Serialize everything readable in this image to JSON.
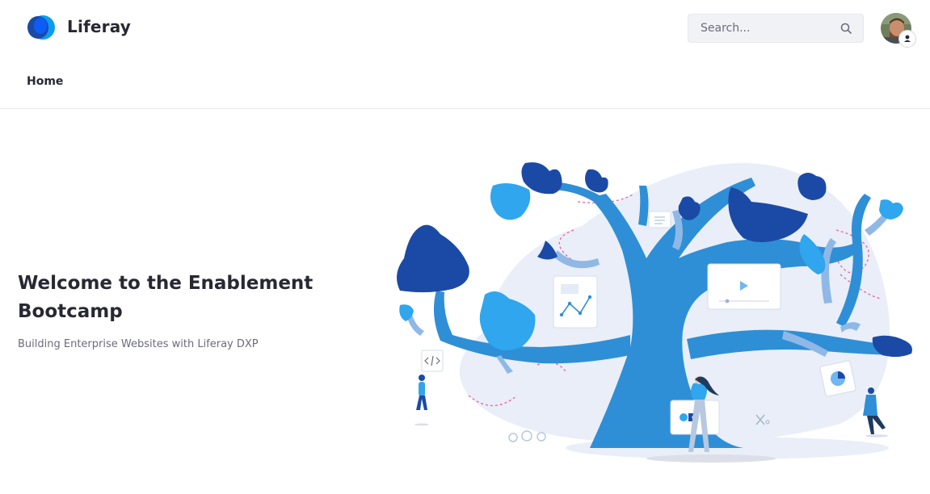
{
  "header": {
    "brand": "Liferay",
    "search": {
      "placeholder": "Search...",
      "value": ""
    }
  },
  "nav": {
    "items": [
      {
        "label": "Home"
      }
    ]
  },
  "hero": {
    "title": "Welcome to the Enablement Bootcamp",
    "subtitle": "Building Enterprise Websites with Liferay DXP"
  },
  "colors": {
    "brand_blue": "#0b5fff",
    "tree_blue": "#2e8fd6",
    "leaf_dark": "#1b4aa6",
    "leaf_light": "#2fa6ee",
    "backdrop": "#e9eef8",
    "accent_pink": "#f06292"
  },
  "icons": {
    "logo": "liferay-logo-icon",
    "search": "search-icon",
    "avatar": "user-avatar",
    "user": "user-icon"
  }
}
